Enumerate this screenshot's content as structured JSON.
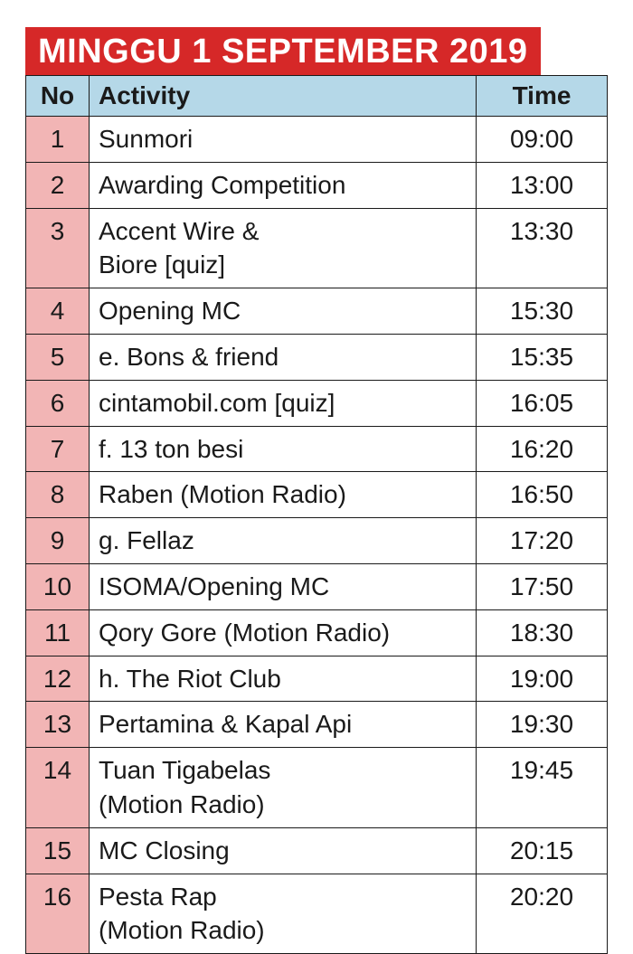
{
  "title": "MINGGU 1 SEPTEMBER 2019",
  "headers": {
    "no": "No",
    "activity": "Activity",
    "time": "Time"
  },
  "rows": [
    {
      "no": "1",
      "activity": "Sunmori",
      "time": "09:00"
    },
    {
      "no": "2",
      "activity": "Awarding Competition",
      "time": "13:00"
    },
    {
      "no": "3",
      "activity": "Accent Wire &\nBiore [quiz]",
      "time": "13:30"
    },
    {
      "no": "4",
      "activity": "Opening MC",
      "time": "15:30"
    },
    {
      "no": "5",
      "activity": "e. Bons & friend",
      "time": "15:35"
    },
    {
      "no": "6",
      "activity": "cintamobil.com [quiz]",
      "time": "16:05"
    },
    {
      "no": "7",
      "activity": "f. 13 ton besi",
      "time": "16:20"
    },
    {
      "no": "8",
      "activity": "Raben (Motion Radio)",
      "time": "16:50"
    },
    {
      "no": "9",
      "activity": "g. Fellaz",
      "time": "17:20"
    },
    {
      "no": "10",
      "activity": "ISOMA/Opening MC",
      "time": "17:50"
    },
    {
      "no": "11",
      "activity": "Qory Gore (Motion Radio)",
      "time": "18:30"
    },
    {
      "no": "12",
      "activity": "h. The Riot Club",
      "time": "19:00"
    },
    {
      "no": "13",
      "activity": "Pertamina & Kapal Api",
      "time": "19:30"
    },
    {
      "no": "14",
      "activity": "Tuan Tigabelas\n(Motion Radio)",
      "time": "19:45"
    },
    {
      "no": "15",
      "activity": "MC Closing",
      "time": "20:15"
    },
    {
      "no": "16",
      "activity": "Pesta Rap\n(Motion Radio)",
      "time": "20:20"
    }
  ]
}
